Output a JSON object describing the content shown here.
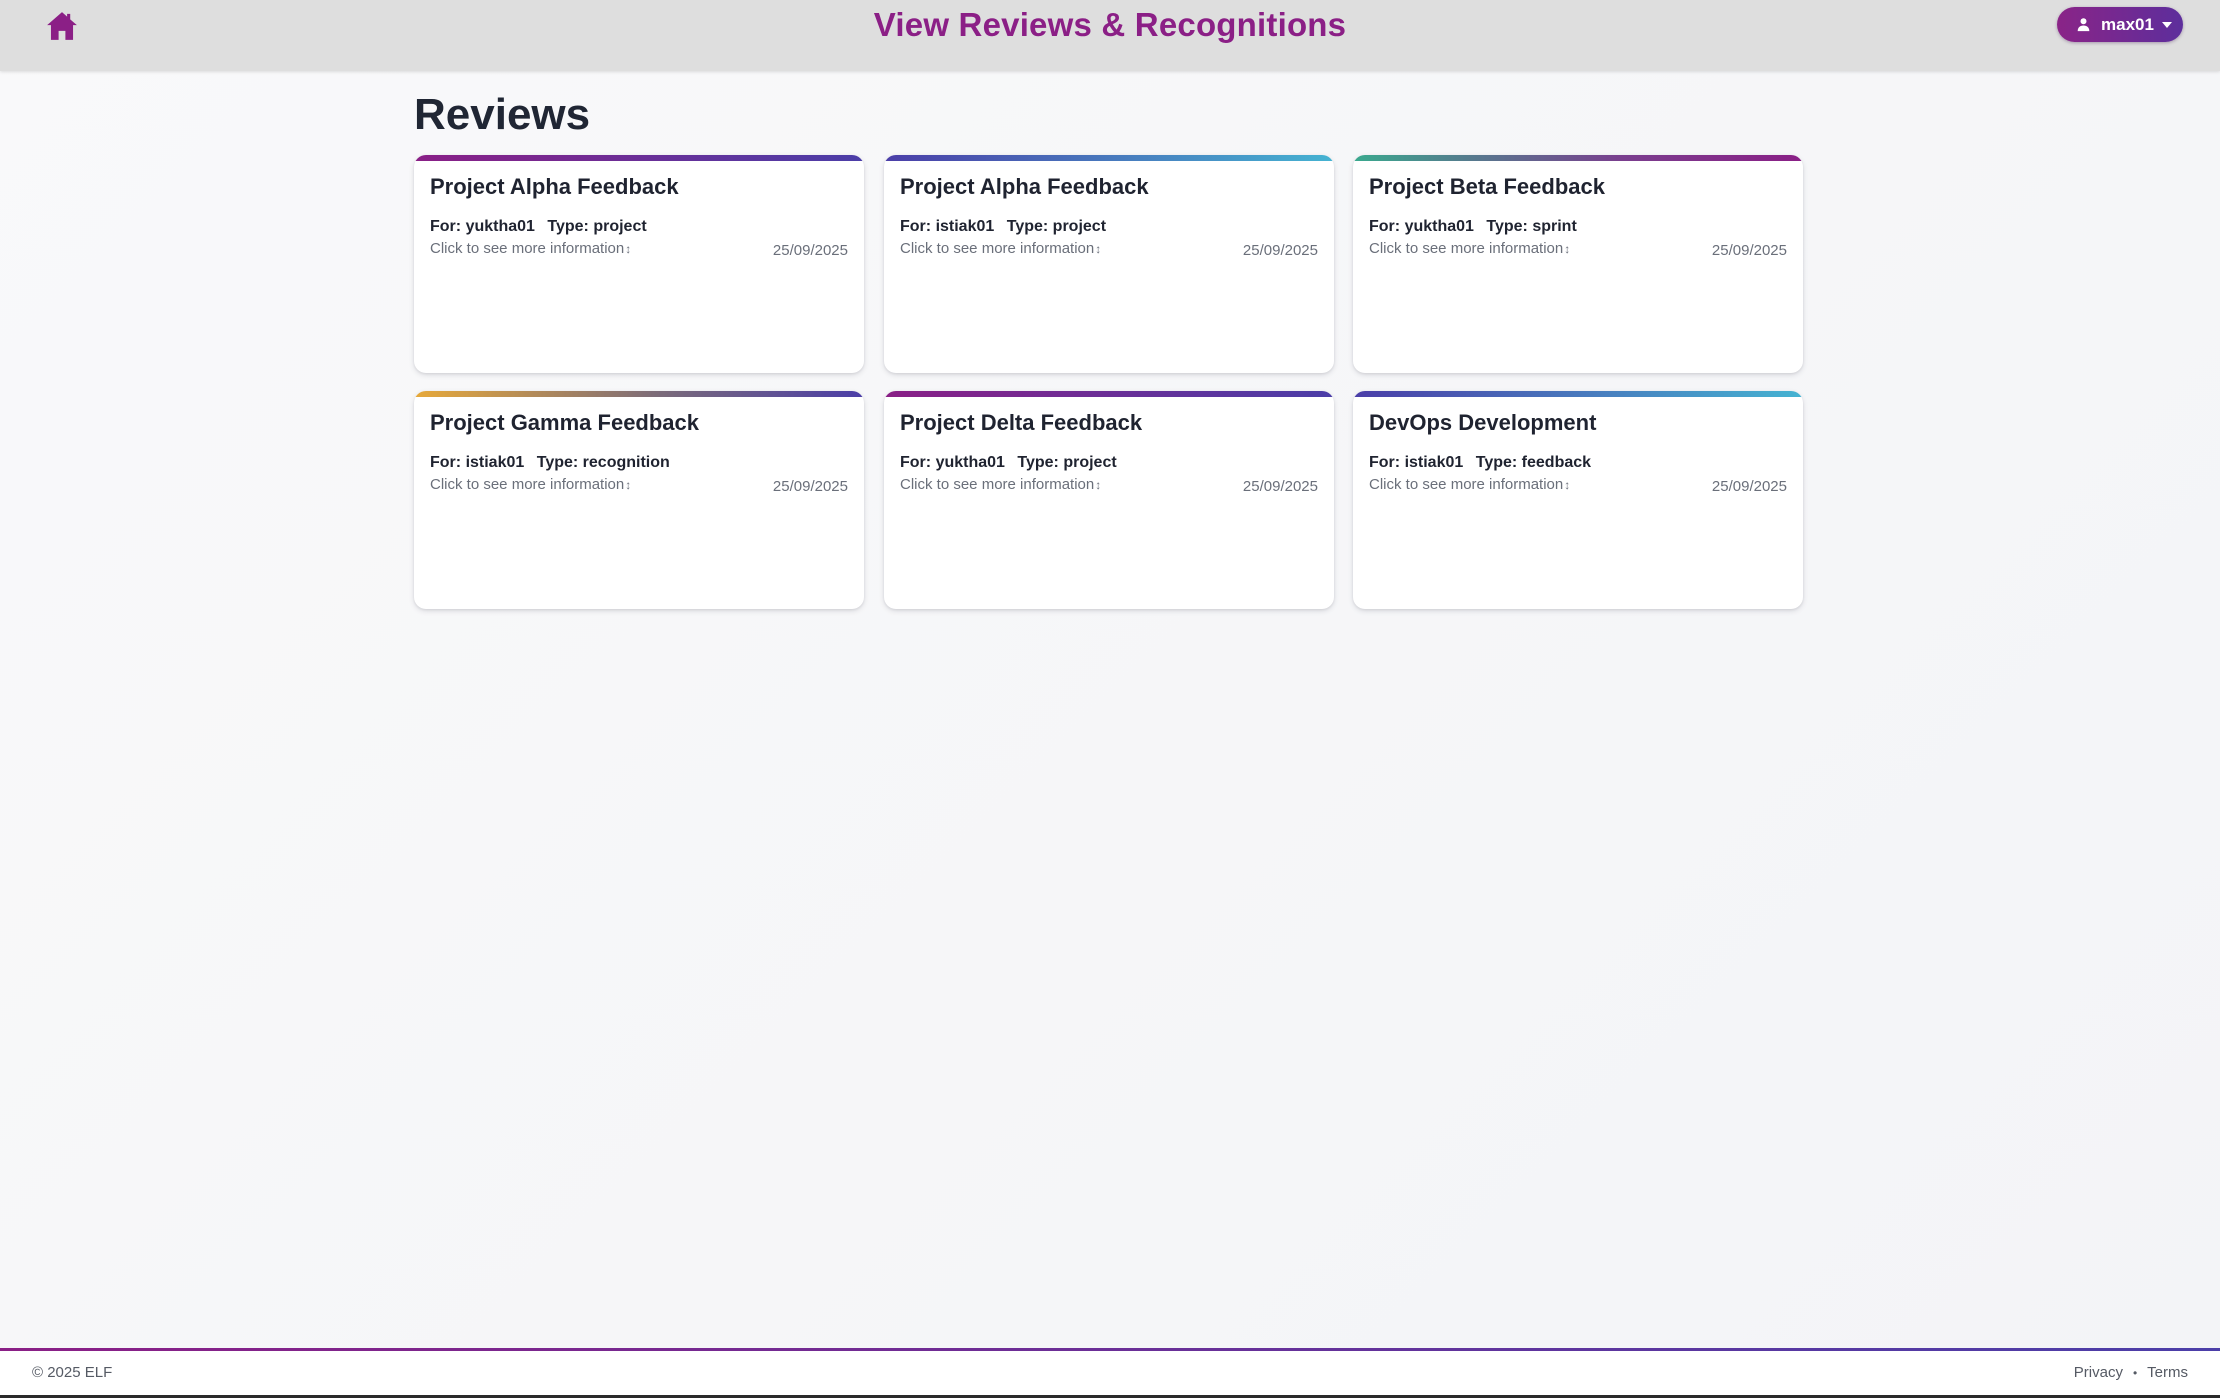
{
  "header": {
    "title": "View Reviews & Recognitions",
    "home_icon": "home-icon",
    "user": {
      "name": "max01",
      "icon": "user-icon",
      "menu_icon": "caret-down-icon"
    },
    "brand_color": "#8b1f86"
  },
  "main": {
    "section_title": "Reviews",
    "cards": [
      {
        "title": "Project Alpha Feedback",
        "for_label": "For:",
        "for_value": "yuktha01",
        "type_label": "Type:",
        "type_value": "project",
        "hint": "Click to see more information",
        "date": "25/09/2025"
      },
      {
        "title": "Project Alpha Feedback",
        "for_label": "For:",
        "for_value": "istiak01",
        "type_label": "Type:",
        "type_value": "project",
        "hint": "Click to see more information",
        "date": "25/09/2025"
      },
      {
        "title": "Project Beta Feedback",
        "for_label": "For:",
        "for_value": "yuktha01",
        "type_label": "Type:",
        "type_value": "sprint",
        "hint": "Click to see more information",
        "date": "25/09/2025"
      },
      {
        "title": "Project Gamma Feedback",
        "for_label": "For:",
        "for_value": "istiak01",
        "type_label": "Type:",
        "type_value": "recognition",
        "hint": "Click to see more information",
        "date": "25/09/2025"
      },
      {
        "title": "Project Delta Feedback",
        "for_label": "For:",
        "for_value": "yuktha01",
        "type_label": "Type:",
        "type_value": "project",
        "hint": "Click to see more information",
        "date": "25/09/2025"
      },
      {
        "title": "DevOps Development",
        "for_label": "For:",
        "for_value": "istiak01",
        "type_label": "Type:",
        "type_value": "feedback",
        "hint": "Click to see more information",
        "date": "25/09/2025"
      }
    ]
  },
  "footer": {
    "copyright": "© 2025 ELF",
    "links": {
      "privacy": "Privacy",
      "separator": "•",
      "terms": "Terms"
    }
  }
}
